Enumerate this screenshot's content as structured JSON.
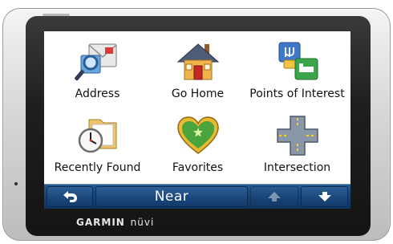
{
  "device": {
    "brand": "GARMIN",
    "model": "nüvi"
  },
  "menu": {
    "items": [
      {
        "label": "Address",
        "icon": "address-book-magnifier-icon"
      },
      {
        "label": "Go Home",
        "icon": "house-icon"
      },
      {
        "label": "Points of Interest",
        "icon": "points-of-interest-icon"
      },
      {
        "label": "Recently Found",
        "icon": "folder-clock-icon"
      },
      {
        "label": "Favorites",
        "icon": "heart-icon"
      },
      {
        "label": "Intersection",
        "icon": "intersection-icon"
      }
    ]
  },
  "toolbar": {
    "back_icon": "back-arrow-icon",
    "near_label": "Near",
    "scroll_up_icon": "arrow-up-icon",
    "scroll_down_icon": "arrow-down-icon"
  },
  "colors": {
    "toolbar": "#174273",
    "bezel": "#1f1f1f",
    "screen": "#ffffff"
  }
}
